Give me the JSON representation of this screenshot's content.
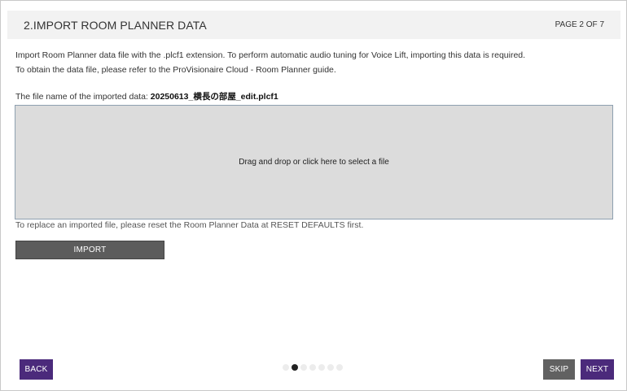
{
  "header": {
    "title": "2.IMPORT ROOM PLANNER DATA",
    "page_indicator": "PAGE 2 OF 7"
  },
  "description": {
    "line1": "Import Room Planner data file with the .plcf1 extension. To perform automatic audio tuning for Voice Lift, importing this data is required.",
    "line2": "To obtain the data file, please refer to the ProVisionaire Cloud - Room Planner guide."
  },
  "file": {
    "label": "The file name of the imported data: ",
    "value": "20250613_横長の部屋_edit.plcf1"
  },
  "dropzone": {
    "text": "Drag and drop or click here to select a file"
  },
  "note": "To replace an imported file, please reset the Room Planner Data at RESET DEFAULTS first.",
  "buttons": {
    "import": "IMPORT",
    "back": "BACK",
    "skip": "SKIP",
    "next": "NEXT"
  },
  "pagination": {
    "total": 7,
    "current": 2
  },
  "colors": {
    "accent": "#4b2a7b",
    "secondary_button": "#616161",
    "import_button": "#5c5c5c",
    "dropzone_bg": "#dcdcdc"
  }
}
